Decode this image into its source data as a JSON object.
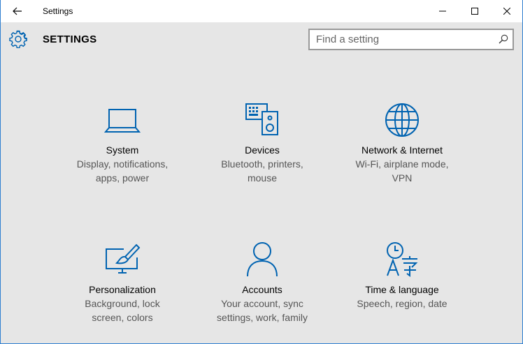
{
  "window": {
    "title": "Settings"
  },
  "header": {
    "title": "SETTINGS"
  },
  "search": {
    "placeholder": "Find a setting"
  },
  "colors": {
    "accent": "#0063b1",
    "border": "#2f7fd0",
    "background": "#e6e6e6"
  },
  "tiles": [
    {
      "icon": "laptop-icon",
      "title": "System",
      "desc_line1": "Display, notifications,",
      "desc_line2": "apps, power"
    },
    {
      "icon": "devices-icon",
      "title": "Devices",
      "desc_line1": "Bluetooth, printers,",
      "desc_line2": "mouse"
    },
    {
      "icon": "globe-icon",
      "title": "Network & Internet",
      "desc_line1": "Wi-Fi, airplane mode,",
      "desc_line2": "VPN"
    },
    {
      "icon": "personalization-icon",
      "title": "Personalization",
      "desc_line1": "Background, lock",
      "desc_line2": "screen, colors"
    },
    {
      "icon": "person-icon",
      "title": "Accounts",
      "desc_line1": "Your account, sync",
      "desc_line2": "settings, work, family"
    },
    {
      "icon": "time-language-icon",
      "title": "Time & language",
      "desc_line1": "Speech, region, date",
      "desc_line2": ""
    }
  ]
}
